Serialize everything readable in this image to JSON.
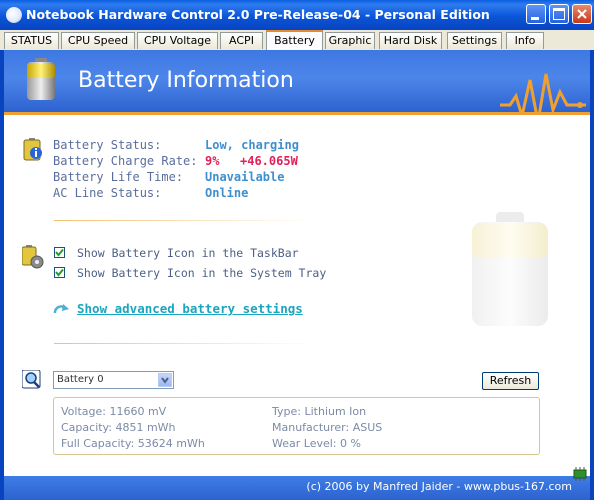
{
  "window": {
    "title": "Notebook Hardware Control 2.0 Pre-Release-04  -  Personal Edition"
  },
  "tabs": [
    {
      "label": "STATUS"
    },
    {
      "label": "CPU Speed"
    },
    {
      "label": "CPU Voltage"
    },
    {
      "label": "ACPI"
    },
    {
      "label": "Battery",
      "active": true
    },
    {
      "label": "Graphic"
    },
    {
      "label": "Hard Disk"
    },
    {
      "label": "Settings"
    },
    {
      "label": "Info"
    }
  ],
  "banner": {
    "title": "Battery Information"
  },
  "status": {
    "labels": {
      "status": "Battery Status:",
      "charge_rate": "Battery Charge Rate:",
      "life_time": "Battery Life Time:",
      "ac_line": "AC Line Status:"
    },
    "values": {
      "status": "Low, charging",
      "charge_pct": "9%",
      "charge_watts": "+46.065W",
      "life_time": "Unavailable",
      "ac_line": "Online"
    }
  },
  "options": {
    "show_taskbar_icon": {
      "label": "Show Battery Icon in the TaskBar",
      "checked": true
    },
    "show_tray_icon": {
      "label": "Show Battery Icon in the System Tray",
      "checked": true
    },
    "advanced_link": "Show advanced battery settings"
  },
  "battery_select": {
    "value": "Battery 0"
  },
  "refresh_label": "Refresh",
  "details": {
    "voltage": "Voltage:  11660 mV",
    "capacity": "Capacity:  4851 mWh",
    "full_capacity": "Full Capacity:  53624 mWh",
    "type": "Type:  Lithium Ion",
    "manufacturer": "Manufacturer:  ASUS",
    "wear_level": "Wear Level:  0 %"
  },
  "footer": {
    "credit": "(c) 2006 by Manfred Jaider  -  www.pbus-167.com"
  },
  "colors": {
    "titlebar": "#0b55d8",
    "banner": "#3d78e2",
    "accent_orange": "#f0a030",
    "value_blue": "#3d8fd0",
    "value_red": "#e0205a",
    "link": "#1aa5c0"
  }
}
